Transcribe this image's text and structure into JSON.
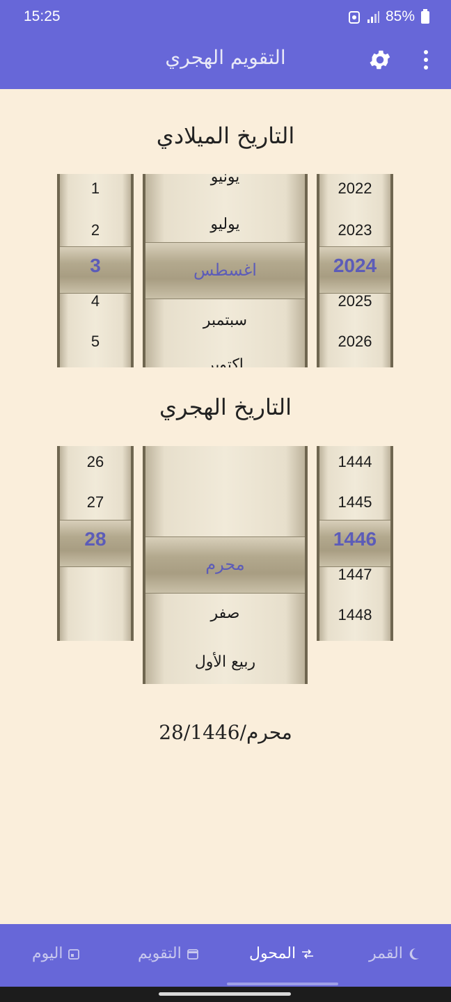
{
  "status": {
    "time": "15:25",
    "battery": "85%"
  },
  "app": {
    "title": "التقويم الهجري"
  },
  "gregorian": {
    "title": "التاريخ الميلادي",
    "days": [
      "1",
      "2",
      "3",
      "4",
      "5"
    ],
    "months_top": "يونيو",
    "months": [
      "يوليو",
      "اغسطس",
      "سبتمبر"
    ],
    "months_bottom": "اكتوبر",
    "years": [
      "2022",
      "2023",
      "2024",
      "2025",
      "2026"
    ]
  },
  "hijri": {
    "title": "التاريخ الهجري",
    "days": [
      "26",
      "27",
      "28"
    ],
    "months": [
      "محرم",
      "صفر",
      "ربيع الأول"
    ],
    "years": [
      "1444",
      "1445",
      "1446",
      "1447",
      "1448"
    ]
  },
  "result": {
    "text": "28/محرم/1446"
  },
  "nav": {
    "moon": "القمر",
    "converter": "المحول",
    "calendar": "التقويم",
    "today": "اليوم"
  },
  "colors": {
    "primary": "#6767d8",
    "background": "#faeedb",
    "selected": "#5c5cb8"
  }
}
